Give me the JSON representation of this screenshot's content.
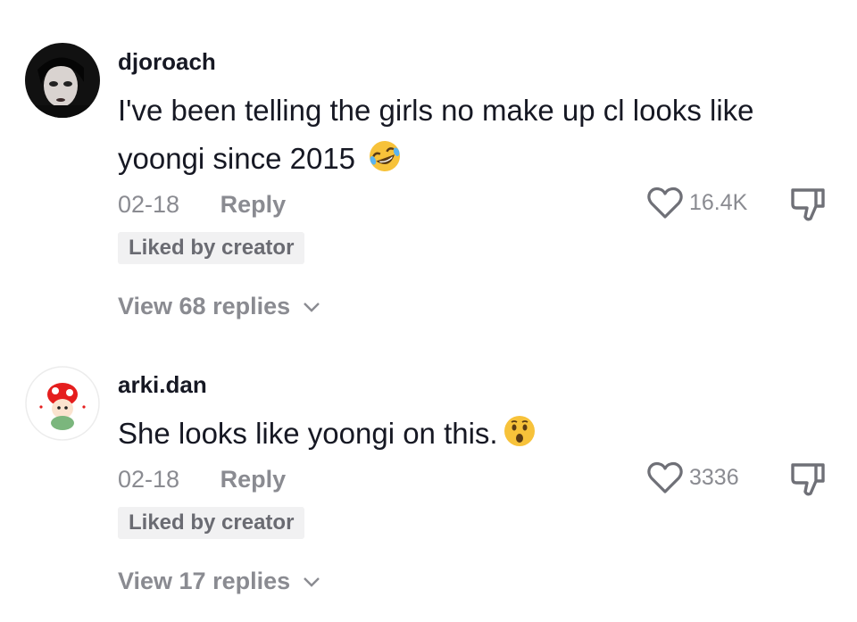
{
  "comments": [
    {
      "username": "djoroach",
      "text_line1": "I've been telling the girls no make up cl looks like",
      "text_line2": "yoongi since 2015",
      "emoji": "rolling-on-floor-laughing-emoji",
      "date": "02-18",
      "reply_label": "Reply",
      "likes": "16.4K",
      "badge": "Liked by creator",
      "view_replies": "View 68 replies"
    },
    {
      "username": "arki.dan",
      "text": "She looks like yoongi on this.",
      "emoji": "hushed-face-emoji",
      "date": "02-18",
      "reply_label": "Reply",
      "likes": "3336",
      "badge": "Liked by creator",
      "view_replies": "View 17 replies"
    }
  ],
  "icons": {
    "like": "heart-outline-icon",
    "dislike": "thumbs-down-icon",
    "expand": "chevron-down-icon"
  },
  "colors": {
    "text": "#161823",
    "muted": "#8a8b91",
    "badge_bg": "#f1f1f2",
    "emoji_yellow": "#f7c23a"
  }
}
